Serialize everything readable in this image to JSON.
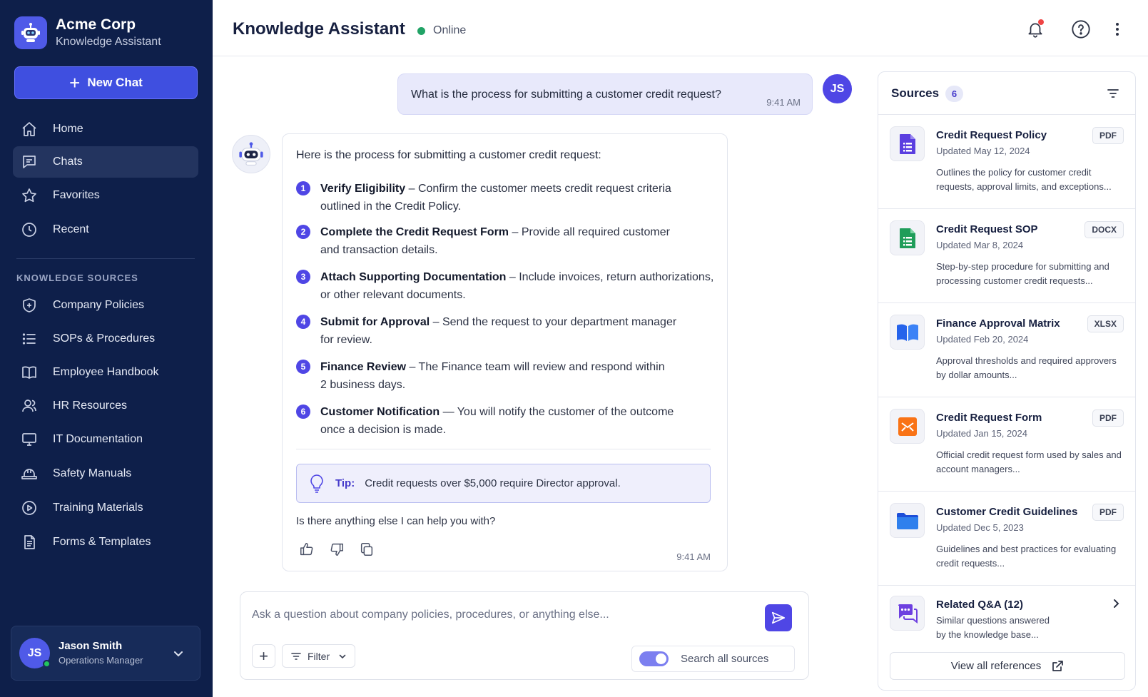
{
  "brand": {
    "name": "Acme Corp",
    "subtitle": "Knowledge Assistant"
  },
  "sidebar": {
    "new_chat_label": "New Chat",
    "nav": [
      {
        "label": "Home",
        "icon": "home-icon"
      },
      {
        "label": "Chats",
        "icon": "chat-icon",
        "active": true
      },
      {
        "label": "Favorites",
        "icon": "star-icon"
      },
      {
        "label": "Recent",
        "icon": "clock-icon"
      }
    ],
    "section_title": "KNOWLEDGE SOURCES",
    "sources": [
      {
        "label": "Company Policies",
        "icon": "shield-icon"
      },
      {
        "label": "SOPs & Procedures",
        "icon": "list-icon"
      },
      {
        "label": "Employee Handbook",
        "icon": "book-icon"
      },
      {
        "label": "HR Resources",
        "icon": "people-icon"
      },
      {
        "label": "IT Documentation",
        "icon": "monitor-icon"
      },
      {
        "label": "Safety Manuals",
        "icon": "hard-hat-icon"
      },
      {
        "label": "Training Materials",
        "icon": "play-circle-icon"
      },
      {
        "label": "Forms & Templates",
        "icon": "document-icon"
      }
    ],
    "user": {
      "initials": "JS",
      "name": "Jason Smith",
      "role": "Operations Manager"
    }
  },
  "header": {
    "title": "Knowledge Assistant",
    "status": "Online"
  },
  "chat": {
    "user_message": {
      "text": "What is the process for submitting a customer credit request?",
      "time": "9:41 AM",
      "initials": "JS"
    },
    "bot_message": {
      "intro": "Here is the process for submitting a customer credit request:",
      "steps": [
        {
          "n": "1",
          "title": "Verify Eligibility",
          "text": " – Confirm the customer meets credit request criteria",
          "text2": "outlined in the Credit Policy."
        },
        {
          "n": "2",
          "title": "Complete the Credit Request Form",
          "text": " – Provide all required customer",
          "text2": "and transaction details."
        },
        {
          "n": "3",
          "title": "Attach Supporting Documentation",
          "text": " – Include invoices, return authorizations,",
          "text2": "or other relevant documents."
        },
        {
          "n": "4",
          "title": "Submit for Approval",
          "text": " – Send the request to your department manager",
          "text2": "for review."
        },
        {
          "n": "5",
          "title": "Finance Review",
          "text": " – The Finance team will review and respond within",
          "text2": "2 business days."
        },
        {
          "n": "6",
          "title": "Customer Notification",
          "text": " — You will notify the customer of the outcome",
          "text2": "once a decision is made."
        }
      ],
      "tip_label": "Tip:",
      "tip_text": "Credit requests over $5,000 require Director approval.",
      "followup": "Is there anything else I can help you with?",
      "time": "9:41 AM"
    }
  },
  "composer": {
    "placeholder": "Ask a question about company policies, procedures, or anything else...",
    "filter_label": "Filter",
    "search_all_label": "Search all sources",
    "search_all_enabled": true
  },
  "sources_panel": {
    "title": "Sources",
    "count": "6",
    "items": [
      {
        "name": "Credit Request Policy",
        "updated": "Updated May 12, 2024",
        "desc": "Outlines the policy for customer credit requests, approval limits, and exceptions...",
        "badge": "PDF",
        "icon": "doc-purple-icon"
      },
      {
        "name": "Credit Request SOP",
        "updated": "Updated Mar 8, 2024",
        "desc": "Step-by-step procedure for submitting and processing customer credit requests...",
        "badge": "DOCX",
        "icon": "sheet-green-icon"
      },
      {
        "name": "Finance Approval Matrix",
        "updated": "Updated Feb 20, 2024",
        "desc": "Approval thresholds and required approvers by dollar amounts...",
        "badge": "XLSX",
        "icon": "book-blue-icon"
      },
      {
        "name": "Credit Request Form",
        "updated": "Updated Jan 15, 2024",
        "desc": "Official credit request form used by sales and account managers...",
        "badge": "PDF",
        "icon": "form-orange-icon"
      },
      {
        "name": "Customer Credit Guidelines",
        "updated": "Updated Dec 5, 2023",
        "desc": "Guidelines and best practices for evaluating credit requests...",
        "badge": "PDF",
        "icon": "folder-blue-icon"
      }
    ],
    "related": {
      "title": "Related Q&A (12)",
      "desc": "Similar questions answered by the knowledge base..."
    },
    "view_all_label": "View all references"
  }
}
